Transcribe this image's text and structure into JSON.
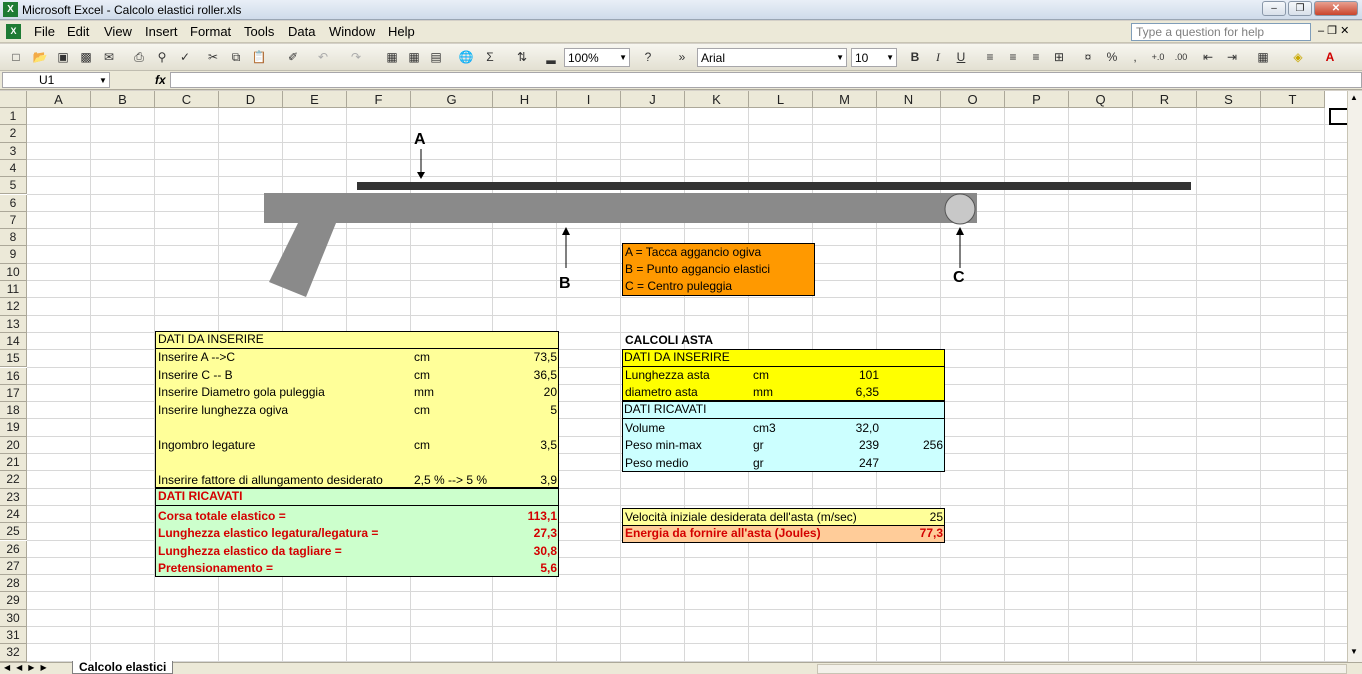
{
  "window": {
    "title": "Microsoft Excel - Calcolo elastici roller.xls"
  },
  "menus": [
    "File",
    "Edit",
    "View",
    "Insert",
    "Format",
    "Tools",
    "Data",
    "Window",
    "Help"
  ],
  "help_placeholder": "Type a question for help",
  "toolbar": {
    "zoom": "100%",
    "font": "Arial",
    "size": "10"
  },
  "namebox": "U1",
  "fx_label": "fx",
  "columns": [
    "A",
    "B",
    "C",
    "D",
    "E",
    "F",
    "G",
    "H",
    "I",
    "J",
    "K",
    "L",
    "M",
    "N",
    "O",
    "P",
    "Q",
    "R",
    "S",
    "T"
  ],
  "rows": [
    "1",
    "2",
    "3",
    "4",
    "5",
    "6",
    "7",
    "8",
    "9",
    "10",
    "11",
    "12",
    "13",
    "14",
    "15",
    "16",
    "17",
    "18",
    "19",
    "20",
    "21",
    "22",
    "23",
    "24",
    "25",
    "26",
    "27",
    "28",
    "29",
    "30",
    "31",
    "32"
  ],
  "diagram": {
    "label_a": "A",
    "label_b": "B",
    "label_c": "C"
  },
  "legend": [
    "A = Tacca aggancio ogiva",
    "B = Punto aggancio elastici",
    "C = Centro puleggia"
  ],
  "left_table": {
    "header": "DATI DA INSERIRE",
    "inputs": [
      {
        "label": "Inserire A -->C",
        "unit": "cm",
        "value": "73,5"
      },
      {
        "label": "Inserire C -- B",
        "unit": "cm",
        "value": "36,5"
      },
      {
        "label": "Inserire Diametro gola puleggia",
        "unit": "mm",
        "value": "20"
      },
      {
        "label": "Inserire lunghezza ogiva",
        "unit": "cm",
        "value": "5"
      },
      {
        "label": "Ingombro legature",
        "unit": "cm",
        "value": "3,5"
      },
      {
        "label": "Inserire fattore di allungamento desiderato",
        "unit": "2,5 % --> 5 %",
        "value": "3,9"
      }
    ],
    "derived_header": "DATI RICAVATI",
    "derived": [
      {
        "label": "Corsa totale elastico =",
        "value": "113,1"
      },
      {
        "label": "Lunghezza elastico legatura/legatura =",
        "value": "27,3"
      },
      {
        "label": "Lunghezza elastico da tagliare =",
        "value": "30,8"
      },
      {
        "label": "Pretensionamento =",
        "value": "5,6"
      }
    ]
  },
  "right_table": {
    "title": "CALCOLI ASTA",
    "header": "DATI DA INSERIRE",
    "inputs": [
      {
        "label": "Lunghezza asta",
        "unit": "cm",
        "value": "101"
      },
      {
        "label": "diametro asta",
        "unit": "mm",
        "value": "6,35"
      }
    ],
    "derived_header": "DATI RICAVATI",
    "derived": [
      {
        "label": "Volume",
        "unit": "cm3",
        "value": "32,0",
        "value2": ""
      },
      {
        "label": "Peso min-max",
        "unit": "gr",
        "value": "239",
        "value2": "256"
      },
      {
        "label": "Peso medio",
        "unit": "gr",
        "value": "247",
        "value2": ""
      }
    ]
  },
  "speed": {
    "label": "Velocità iniziale desiderata dell'asta (m/sec)",
    "value": "25"
  },
  "energy": {
    "label": "Energia da fornire all'asta (Joules)",
    "value": "77,3"
  },
  "sheet_tab": "Calcolo elastici",
  "colors": {
    "yellow": "#ffff99",
    "green": "#ccffcc",
    "cyan": "#ccffff",
    "orange": "#ff9900",
    "bright_yellow": "#ffff00",
    "red_text": "#d40000"
  }
}
